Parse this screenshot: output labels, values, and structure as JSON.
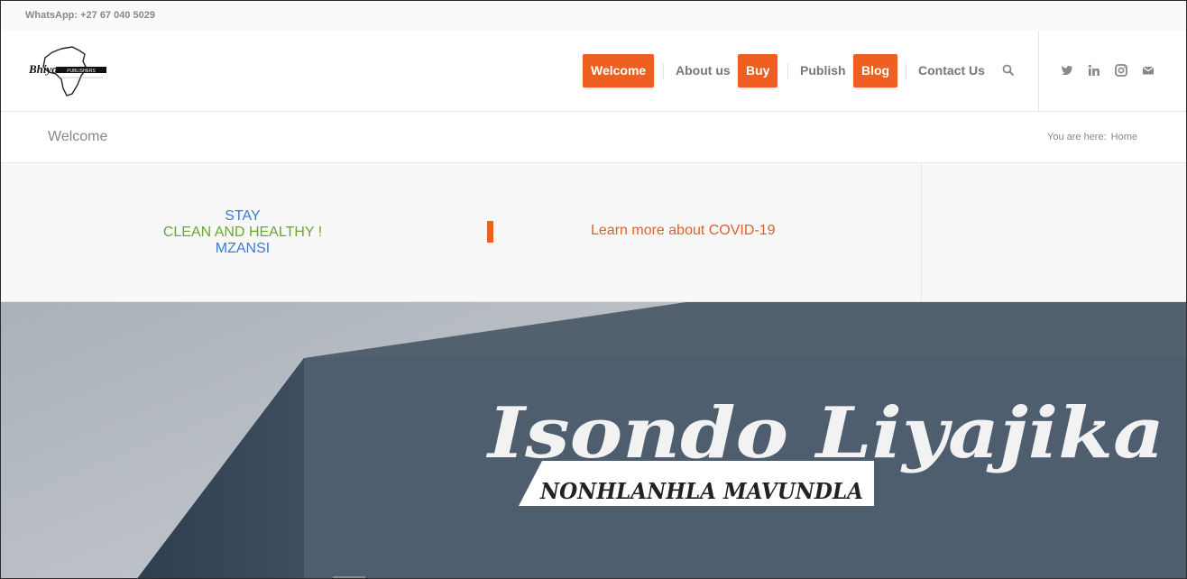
{
  "topbar": {
    "whatsapp": "WhatsApp: +27 67 040 5029"
  },
  "logo": {
    "text": "Bhiyoza",
    "sub": "PUBLISHERS"
  },
  "nav": {
    "items": [
      {
        "label": "Welcome",
        "style": "button"
      },
      {
        "label": "About us",
        "style": "link"
      },
      {
        "label": "Buy",
        "style": "button"
      },
      {
        "label": "Publish",
        "style": "link"
      },
      {
        "label": "Blog",
        "style": "button"
      },
      {
        "label": "Contact Us",
        "style": "link"
      }
    ],
    "search_icon": "search-icon",
    "social_icons": [
      "twitter-icon",
      "linkedin-icon",
      "instagram-icon",
      "mail-icon"
    ]
  },
  "titlebar": {
    "page_title": "Welcome",
    "breadcrumb_prefix": "You are here:",
    "breadcrumb_home": "Home"
  },
  "banner": {
    "line1": "STAY",
    "line2": "CLEAN AND HEALTHY !",
    "line3": "MZANSI",
    "covid_link": "Learn more about COVID-19"
  },
  "hero": {
    "book_title": "Isondo Liyajika",
    "author": "NONHLANHLA MAVUNDLA"
  },
  "colors": {
    "accent": "#ef5f22",
    "slogan_blue": "#3a7bd5",
    "slogan_green": "#6aa635",
    "hero_bg": "#4d5d6d"
  }
}
